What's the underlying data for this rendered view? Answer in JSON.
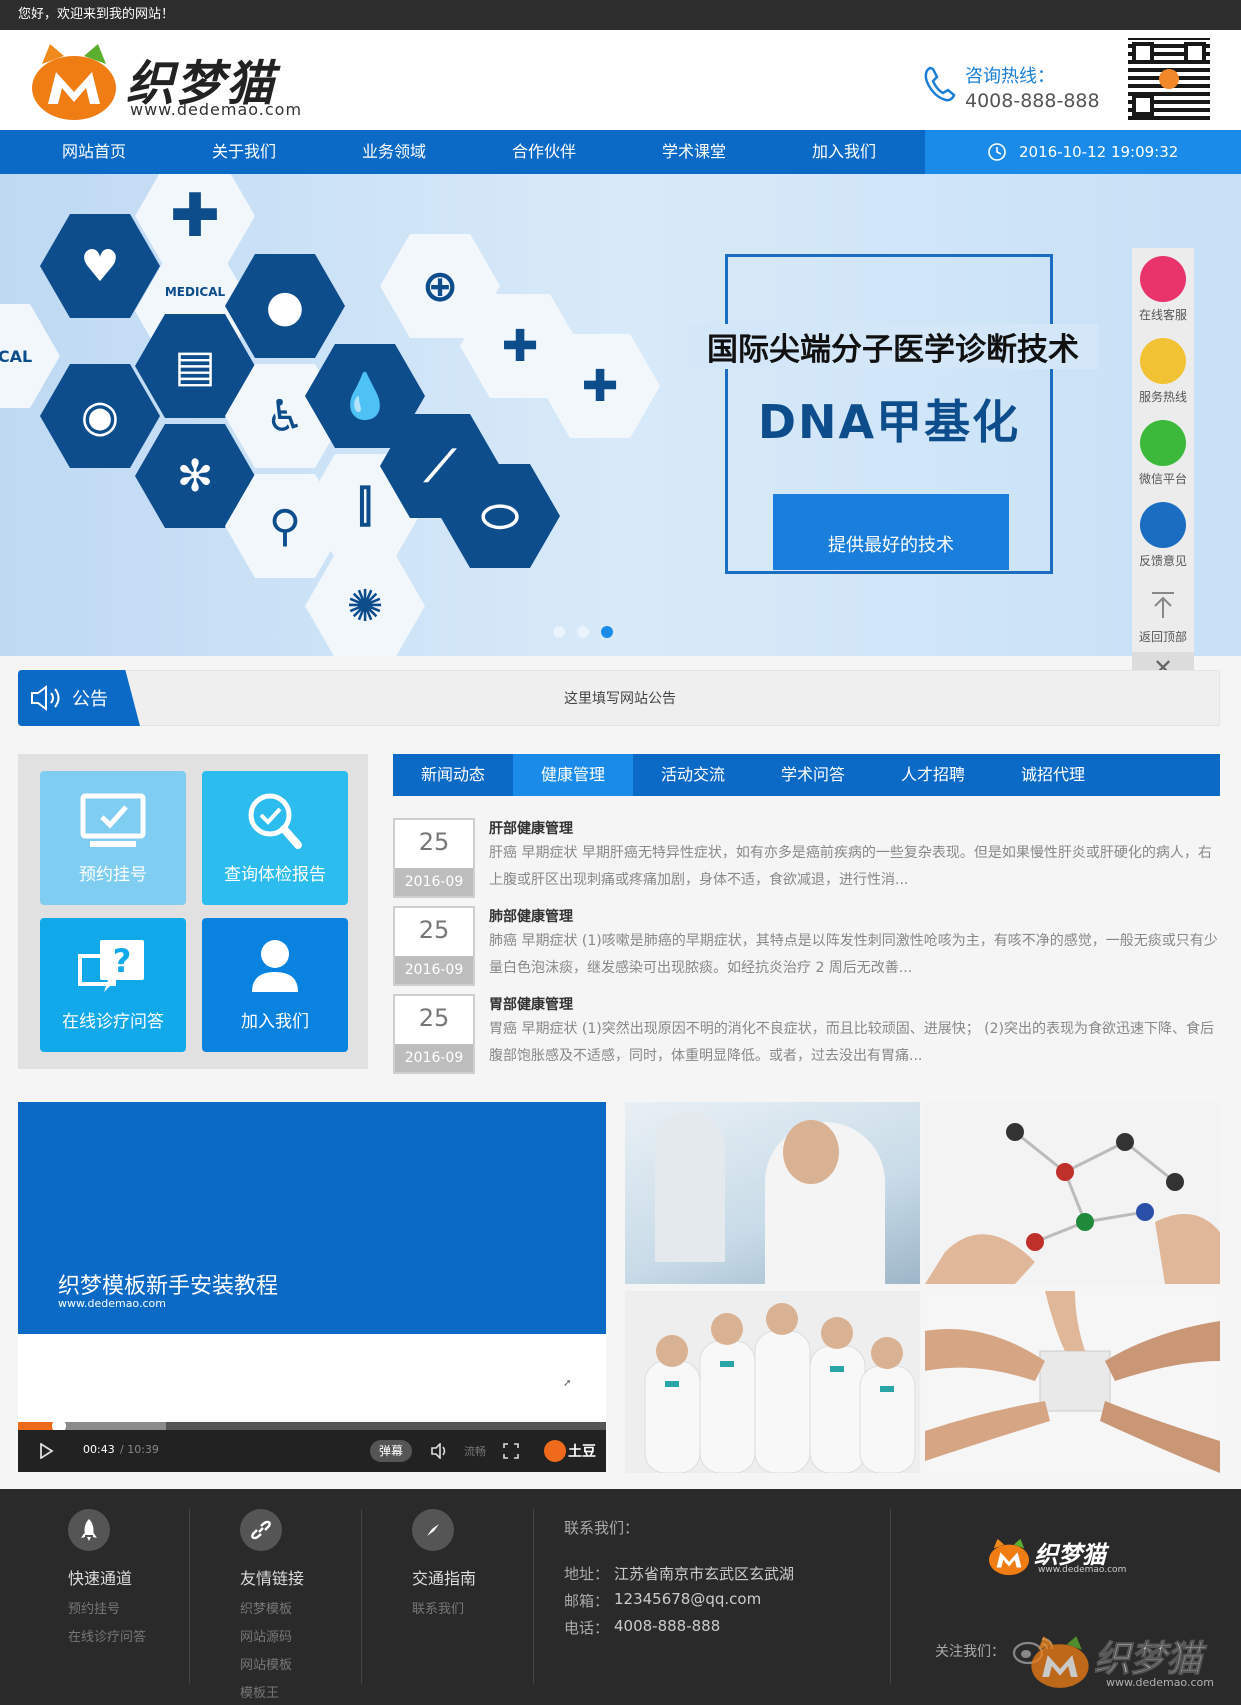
{
  "topbar": {
    "welcome": "您好，欢迎来到我的网站！"
  },
  "header": {
    "logo_text": "织梦猫",
    "logo_url": "www.dedemao.com",
    "hotline_label": "咨询热线：",
    "hotline_number": "4008-888-888"
  },
  "nav": {
    "items": [
      "网站首页",
      "关于我们",
      "业务领域",
      "合作伙伴",
      "学术课堂",
      "加入我们"
    ],
    "datetime": "2016-10-12 19:09:32"
  },
  "banner": {
    "headline": "国际尖端分子医学诊断技术",
    "subheadline": "DNA甲基化",
    "button": "提供最好的技术",
    "hex_labels": [
      "MEDICAL",
      "MEDICAL",
      "MEDICAL",
      "EDICAL"
    ]
  },
  "sidefloat": {
    "items": [
      "在线客服",
      "服务热线",
      "微信平台",
      "反馈意见",
      "返回顶部"
    ],
    "close": "✕"
  },
  "notice": {
    "label": "公告",
    "text": "这里填写网站公告"
  },
  "quick": {
    "buttons": [
      "预约挂号",
      "查询体检报告",
      "在线诊疗问答",
      "加入我们"
    ]
  },
  "tabs": {
    "items": [
      "新闻动态",
      "健康管理",
      "活动交流",
      "学术问答",
      "人才招聘",
      "诚招代理"
    ],
    "active_index": 1
  },
  "news": [
    {
      "day": "25",
      "ym": "2016-09",
      "title": "肝部健康管理",
      "desc": "肝癌 早期症状 早期肝癌无特异性症状，如有亦多是癌前疾病的一些复杂表现。但是如果慢性肝炎或肝硬化的病人，右上腹或肝区出现刺痛或疼痛加剧，身体不适，食欲减退，进行性消..."
    },
    {
      "day": "25",
      "ym": "2016-09",
      "title": "肺部健康管理",
      "desc": "肺癌 早期症状 (1)咳嗽是肺癌的早期症状，其特点是以阵发性刺同激性呛咳为主，有咳不净的感觉，一般无痰或只有少量白色泡沫痰，继发感染可出现脓痰。如经抗炎治疗 2 周后无改善..."
    },
    {
      "day": "25",
      "ym": "2016-09",
      "title": "胃部健康管理",
      "desc": "胃癌 早期症状 (1)突然出现原因不明的消化不良症状，而且比较顽固、进展快； (2)突出的表现为食欲迅速下降、食后腹部饱胀感及不适感，同时，体重明显降低。或者，过去没出有胃痛..."
    }
  ],
  "video": {
    "title": "织梦模板新手安装教程",
    "url": "www.dedemao.com",
    "time_current": "00:43",
    "time_total": "/ 10:39",
    "danmu": "弹幕",
    "quality": "流畅",
    "brand": "土豆",
    "progress": 0.07
  },
  "footer": {
    "cols": [
      {
        "title": "快速通道",
        "links": [
          "预约挂号",
          "在线诊疗问答"
        ]
      },
      {
        "title": "友情链接",
        "links": [
          "织梦模板",
          "网站源码",
          "网站模板",
          "模板王"
        ]
      },
      {
        "title": "交通指南",
        "links": [
          "联系我们"
        ]
      }
    ],
    "contact_title": "联系我们：",
    "address_label": "地址：",
    "address": "江苏省南京市玄武区玄武湖",
    "email_label": "邮箱：",
    "email": "12345678@qq.com",
    "phone_label": "电话：",
    "phone": "4008-888-888",
    "follow": "关注我们：",
    "logo_text": "织梦猫",
    "logo_url": "www.dedemao.com"
  }
}
